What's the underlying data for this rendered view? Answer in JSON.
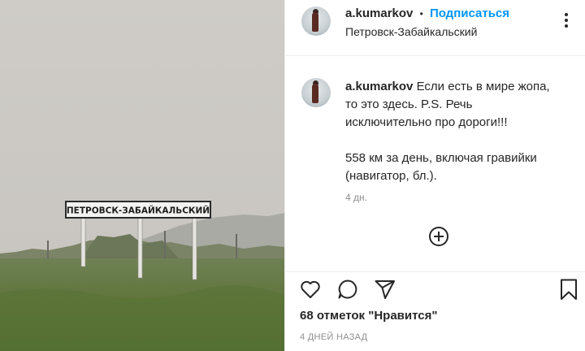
{
  "post": {
    "sign_text": "ПЕТРОВСК-ЗАБАЙКАЛЬСКИЙ"
  },
  "header": {
    "username": "a.kumarkov",
    "separator": "•",
    "follow_label": "Подписаться",
    "location": "Петровск-Забайкальский",
    "more_icon": "more-options-icon"
  },
  "caption": {
    "username": "a.kumarkov",
    "lines": [
      "Если есть в мире жопа,",
      "то это здесь. P.S. Речь",
      "исключительно про дороги!!!",
      "558 км за день, включая гравийки",
      "(навигатор, бл.)."
    ],
    "time": "4 дн."
  },
  "actions": {
    "like_icon": "heart-icon",
    "comment_icon": "comment-icon",
    "share_icon": "share-icon",
    "save_icon": "bookmark-icon",
    "add_comment_icon": "plus-circle-icon"
  },
  "likes_text": "68 отметок \"Нравится\"",
  "post_date": "4 ДНЕЙ НАЗАД",
  "colors": {
    "accent": "#0095f6",
    "text": "#262626",
    "muted": "#8e8e8e",
    "border": "#efefef"
  }
}
